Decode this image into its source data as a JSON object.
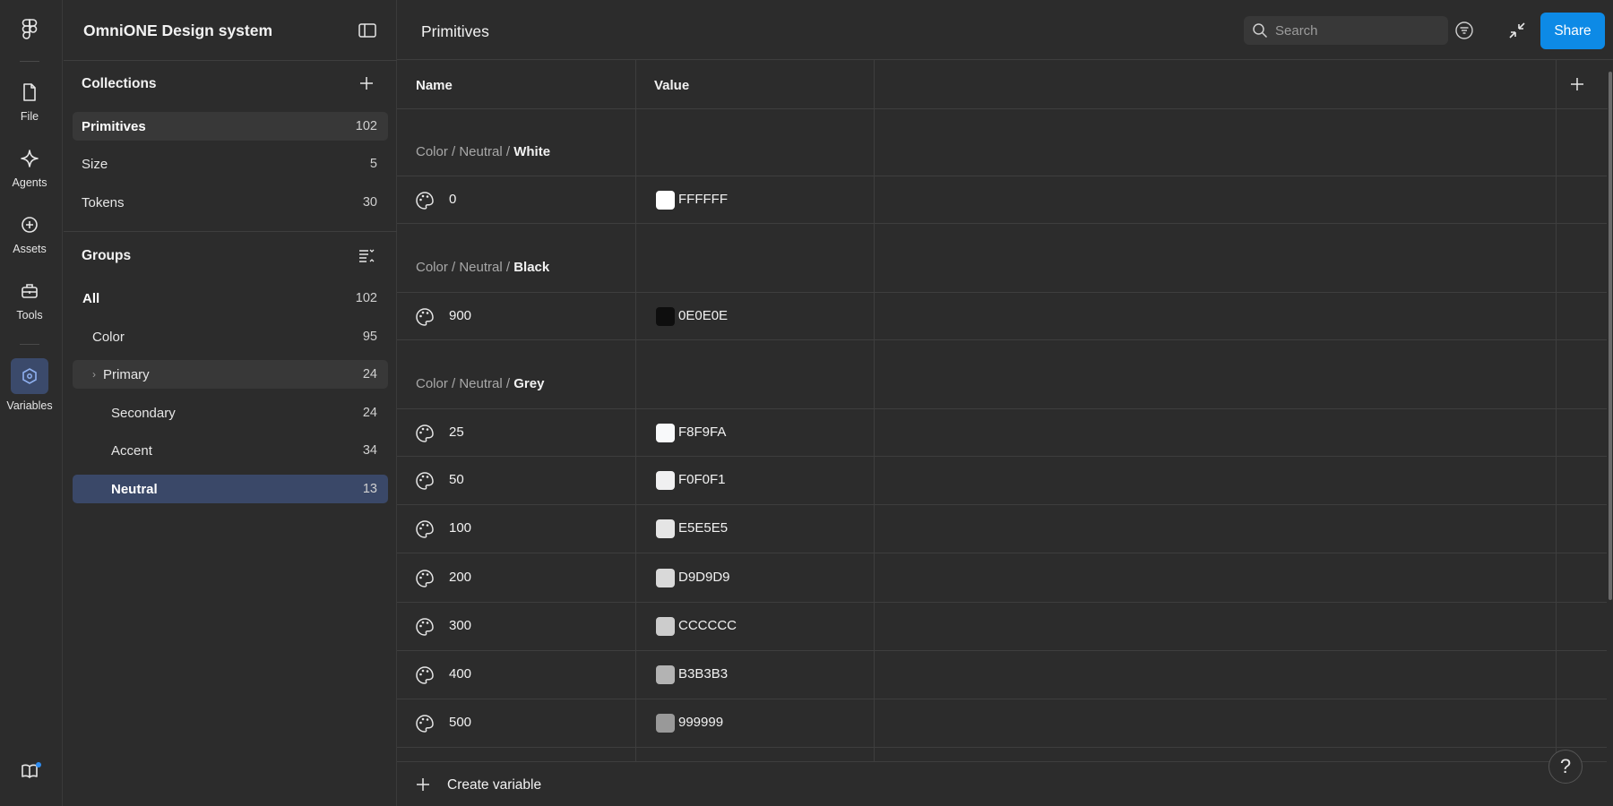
{
  "rail": {
    "items": [
      {
        "label": "File",
        "icon": "file-icon"
      },
      {
        "label": "Agents",
        "icon": "sparkle-icon"
      },
      {
        "label": "Assets",
        "icon": "plus-circle-icon"
      },
      {
        "label": "Tools",
        "icon": "toolbox-icon"
      },
      {
        "label": "Variables",
        "icon": "hexagon-icon",
        "active": true
      }
    ]
  },
  "sidebar": {
    "title": "OmniONE Design system",
    "collections_heading": "Collections",
    "collections": [
      {
        "label": "Primitives",
        "count": "102",
        "selected": true
      },
      {
        "label": "Size",
        "count": "5"
      },
      {
        "label": "Tokens",
        "count": "30"
      }
    ],
    "groups_heading": "Groups",
    "groups": [
      {
        "label": "All",
        "count": "102"
      },
      {
        "label": "Color",
        "count": "95"
      },
      {
        "label": "Primary",
        "count": "24"
      },
      {
        "label": "Secondary",
        "count": "24"
      },
      {
        "label": "Accent",
        "count": "34"
      },
      {
        "label": "Neutral",
        "count": "13",
        "selected": true
      }
    ]
  },
  "header": {
    "title": "Primitives",
    "search_placeholder": "Search",
    "share_label": "Share"
  },
  "table": {
    "col_name": "Name",
    "col_value": "Value",
    "groups": [
      {
        "path": "Color / Neutral / ",
        "leaf": "White",
        "rows": [
          {
            "name": "0",
            "value": "FFFFFF",
            "color": "#FFFFFF"
          }
        ]
      },
      {
        "path": "Color / Neutral / ",
        "leaf": "Black",
        "rows": [
          {
            "name": "900",
            "value": "0E0E0E",
            "color": "#0E0E0E"
          }
        ]
      },
      {
        "path": "Color / Neutral / ",
        "leaf": "Grey",
        "rows": [
          {
            "name": "25",
            "value": "F8F9FA",
            "color": "#F8F9FA"
          },
          {
            "name": "50",
            "value": "F0F0F1",
            "color": "#F0F0F1"
          },
          {
            "name": "100",
            "value": "E5E5E5",
            "color": "#E5E5E5"
          },
          {
            "name": "200",
            "value": "D9D9D9",
            "color": "#D9D9D9"
          },
          {
            "name": "300",
            "value": "CCCCCC",
            "color": "#CCCCCC"
          },
          {
            "name": "400",
            "value": "B3B3B3",
            "color": "#B3B3B3"
          },
          {
            "name": "500",
            "value": "999999",
            "color": "#999999"
          }
        ]
      }
    ]
  },
  "footer": {
    "create_label": "Create variable",
    "help_label": "?"
  },
  "colors": {
    "accent": "#0D8AE6",
    "selected_row": "#3A4868",
    "background": "#2C2C2C"
  }
}
